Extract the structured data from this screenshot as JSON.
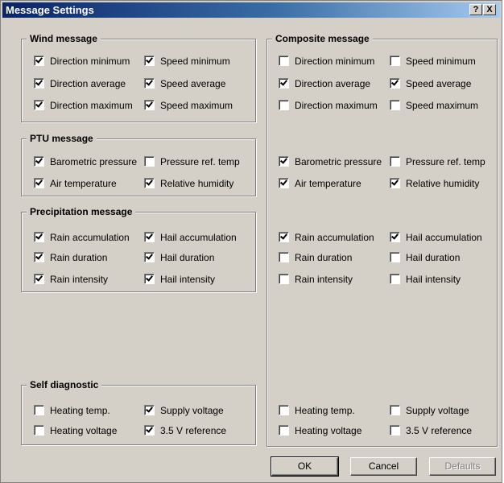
{
  "window": {
    "title": "Message Settings",
    "help_glyph": "?",
    "close_glyph": "X"
  },
  "left": {
    "wind": {
      "label": "Wind message",
      "items": [
        {
          "label": "Direction minimum",
          "checked": true
        },
        {
          "label": "Speed minimum",
          "checked": true
        },
        {
          "label": "Direction average",
          "checked": true
        },
        {
          "label": "Speed average",
          "checked": true
        },
        {
          "label": "Direction maximum",
          "checked": true
        },
        {
          "label": "Speed maximum",
          "checked": true
        }
      ]
    },
    "ptu": {
      "label": "PTU message",
      "items": [
        {
          "label": "Barometric pressure",
          "checked": true
        },
        {
          "label": "Pressure ref. temp",
          "checked": false
        },
        {
          "label": "Air temperature",
          "checked": true
        },
        {
          "label": "Relative humidity",
          "checked": true
        }
      ]
    },
    "precip": {
      "label": "Precipitation message",
      "items": [
        {
          "label": "Rain accumulation",
          "checked": true
        },
        {
          "label": "Hail accumulation",
          "checked": true
        },
        {
          "label": "Rain duration",
          "checked": true
        },
        {
          "label": "Hail duration",
          "checked": true
        },
        {
          "label": "Rain intensity",
          "checked": true
        },
        {
          "label": "Hail intensity",
          "checked": true
        }
      ]
    },
    "selfdiag": {
      "label": "Self diagnostic",
      "items": [
        {
          "label": "Heating temp.",
          "checked": false
        },
        {
          "label": "Supply voltage",
          "checked": true
        },
        {
          "label": "Heating voltage",
          "checked": false
        },
        {
          "label": "3.5 V reference",
          "checked": true
        }
      ]
    }
  },
  "composite": {
    "label": "Composite message",
    "items": [
      {
        "label": "Direction minimum",
        "checked": false
      },
      {
        "label": "Speed minimum",
        "checked": false
      },
      {
        "label": "Direction average",
        "checked": true
      },
      {
        "label": "Speed average",
        "checked": true
      },
      {
        "label": "Direction maximum",
        "checked": false
      },
      {
        "label": "Speed maximum",
        "checked": false
      },
      {
        "label": "Barometric pressure",
        "checked": true
      },
      {
        "label": "Pressure ref. temp",
        "checked": false
      },
      {
        "label": "Air temperature",
        "checked": true
      },
      {
        "label": "Relative humidity",
        "checked": true
      },
      {
        "label": "Rain accumulation",
        "checked": true
      },
      {
        "label": "Hail accumulation",
        "checked": true
      },
      {
        "label": "Rain duration",
        "checked": false
      },
      {
        "label": "Hail duration",
        "checked": false
      },
      {
        "label": "Rain intensity",
        "checked": false
      },
      {
        "label": "Hail intensity",
        "checked": false
      },
      {
        "label": "Heating temp.",
        "checked": false
      },
      {
        "label": "Supply voltage",
        "checked": false
      },
      {
        "label": "Heating voltage",
        "checked": false
      },
      {
        "label": "3.5 V reference",
        "checked": false
      }
    ]
  },
  "buttons": {
    "ok": "OK",
    "cancel": "Cancel",
    "defaults": "Defaults"
  }
}
